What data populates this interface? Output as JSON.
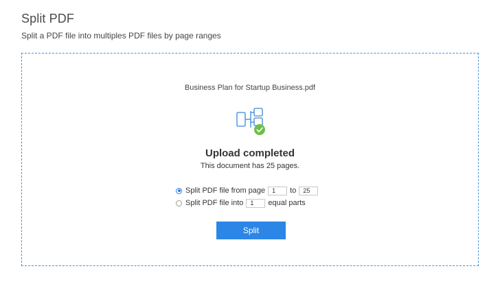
{
  "header": {
    "title": "Split PDF",
    "subtitle": "Split a PDF file into multiples PDF files by page ranges"
  },
  "upload": {
    "file_name": "Business Plan for Startup Business.pdf",
    "icon": "split-pdf-icon",
    "badge_icon": "check-icon",
    "status_title": "Upload completed",
    "status_text": "This document has 25 pages."
  },
  "options": {
    "range": {
      "selected": true,
      "label_before": "Split PDF file from page",
      "from_value": "1",
      "label_to": "to",
      "to_value": "25"
    },
    "equal": {
      "selected": false,
      "label_before": "Split PDF file into",
      "parts_value": "1",
      "label_after": "equal parts"
    }
  },
  "actions": {
    "split_label": "Split"
  },
  "colors": {
    "accent": "#2b86e6",
    "dropzone_border": "#4a90d9",
    "success": "#6cc04a"
  }
}
